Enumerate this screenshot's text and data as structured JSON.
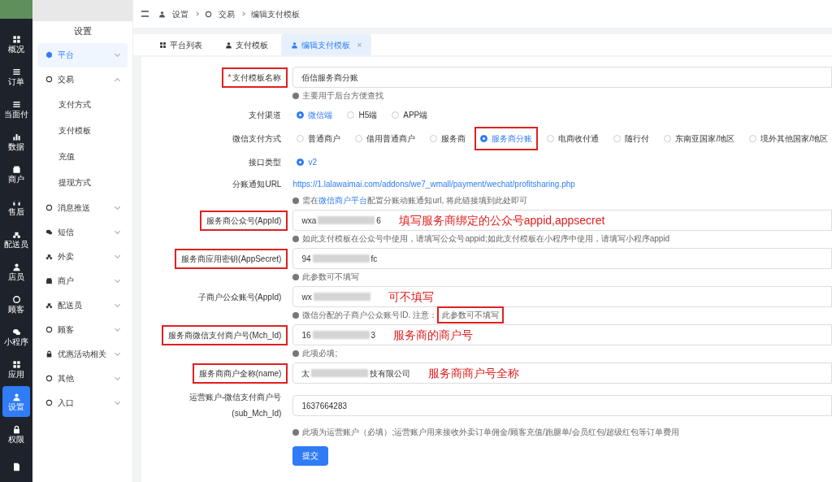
{
  "nav": [
    {
      "label": "概况",
      "selected": false
    },
    {
      "label": "订单",
      "selected": false
    },
    {
      "label": "当面付",
      "selected": false
    },
    {
      "label": "数据",
      "selected": false
    },
    {
      "label": "商户",
      "selected": false
    },
    {
      "label": "售后",
      "selected": false
    },
    {
      "label": "配送员",
      "selected": false
    },
    {
      "label": "店员",
      "selected": false
    },
    {
      "label": "顾客",
      "selected": false
    },
    {
      "label": "小程序",
      "selected": false
    },
    {
      "label": "应用",
      "selected": false
    },
    {
      "label": "设置",
      "selected": true
    },
    {
      "label": "权限",
      "selected": false
    },
    {
      "selected": false
    }
  ],
  "sidebar": {
    "title": "设置",
    "items": [
      {
        "label": "平台",
        "selected": true,
        "expanded": false
      },
      {
        "label": "交易",
        "selected": false,
        "expanded": true,
        "children": [
          {
            "label": "支付方式"
          },
          {
            "label": "支付模板"
          },
          {
            "label": "充值"
          },
          {
            "label": "提现方式"
          }
        ]
      },
      {
        "label": "消息推送",
        "selected": false,
        "expanded": false
      },
      {
        "label": "短信",
        "selected": false,
        "expanded": false
      },
      {
        "label": "外卖",
        "selected": false,
        "expanded": false
      },
      {
        "label": "商户",
        "selected": false,
        "expanded": false
      },
      {
        "label": "配送员",
        "selected": false,
        "expanded": false
      },
      {
        "label": "顾客",
        "selected": false,
        "expanded": false
      },
      {
        "label": "优惠活动相关",
        "selected": false,
        "expanded": false
      },
      {
        "label": "其他",
        "selected": false,
        "expanded": false
      },
      {
        "label": "入口",
        "selected": false,
        "expanded": false
      }
    ]
  },
  "breadcrumb": [
    "设置",
    "交易",
    "编辑支付模板"
  ],
  "tabs": [
    {
      "label": "平台列表",
      "selected": false
    },
    {
      "label": "支付模板",
      "selected": false
    },
    {
      "label": "编辑支付模板",
      "selected": true,
      "close": "×"
    }
  ],
  "form": [
    {
      "kind": "input",
      "label": "支付模板名称",
      "required_mark": "*",
      "highlighted": true,
      "value": "佰信服务商分账",
      "hint": [
        {
          "text": "主要用于后台方便查找"
        }
      ]
    },
    {
      "kind": "radio",
      "label": "支付渠道",
      "options": [
        {
          "label": "微信端",
          "selected": true
        },
        {
          "label": "H5端",
          "selected": false
        },
        {
          "label": "APP端",
          "selected": false
        }
      ]
    },
    {
      "kind": "radio",
      "label": "微信支付方式",
      "options": [
        {
          "label": "普通商户",
          "selected": false
        },
        {
          "label": "借用普通商户",
          "selected": false
        },
        {
          "label": "服务商",
          "selected": false
        },
        {
          "label": "服务商分账",
          "selected": true,
          "highlighted": true
        },
        {
          "label": "电商收付通",
          "selected": false
        },
        {
          "label": "随行付",
          "selected": false
        },
        {
          "label": "东南亚国家/地区",
          "selected": false
        },
        {
          "label": "境外其他国家/地区",
          "selected": false
        }
      ]
    },
    {
      "kind": "radio",
      "label": "接口类型",
      "options": [
        {
          "label": "v2",
          "selected": true
        }
      ]
    },
    {
      "kind": "link",
      "label": "分账通知URL",
      "value": "https://1.lalawaimai.com/addons/we7_wmall/payment/wechat/profitsharing.php",
      "hint": [
        {
          "text": "需在"
        },
        {
          "text": "微信商户平台",
          "link": true
        },
        {
          "text": "配置分账动账通知url, 将此链接填到此处即可"
        }
      ]
    },
    {
      "kind": "input",
      "label": "服务商公众号(AppId)",
      "highlighted": true,
      "value_start": "wxa",
      "blurred": true,
      "value_end": "6",
      "note": "填写服务商绑定的公众号appid,appsecret",
      "hint": [
        {
          "text": "如此支付模板在公众号中使用，请填写公众号appid;如此支付模板在小程序中使用，请填写小程序appid"
        }
      ]
    },
    {
      "kind": "input",
      "label": "服务商应用密钥(AppSecret)",
      "highlighted": true,
      "value_start": "94",
      "blurred": true,
      "value_end": "fc",
      "hint": [
        {
          "text": "此参数可不填写"
        }
      ]
    },
    {
      "kind": "input",
      "label": "子商户公众账号(AppId)",
      "value_start": "wx",
      "blurred": true,
      "note": "可不填写",
      "hint": [
        {
          "text": "微信分配的子商户公众账号ID. 注意："
        },
        {
          "text": "此参数可不填写",
          "highlighted": true
        }
      ]
    },
    {
      "kind": "input",
      "label": "服务商微信支付商户号(Mch_Id)",
      "highlighted": true,
      "value_start": "16",
      "blurred": true,
      "value_end": "3",
      "note": "服务商的商户号",
      "hint": [
        {
          "text": "此项必填;"
        }
      ]
    },
    {
      "kind": "input",
      "label": "服务商商户全称(name)",
      "highlighted": true,
      "value_start": "太",
      "blurred": true,
      "value_end": "技有限公司",
      "note": "服务商商户号全称"
    },
    {
      "kind": "input",
      "label": "运营账户-微信支付商户号",
      "label2": "(sub_Mch_Id)",
      "value": "1637664283",
      "hint": [
        {
          "text": "此项为运营账户（必填）;运营账户用来接收外卖订单佣金/顾客充值/跑腿单/会员红包/超级红包等订单费用"
        }
      ]
    }
  ],
  "submit": "提交"
}
